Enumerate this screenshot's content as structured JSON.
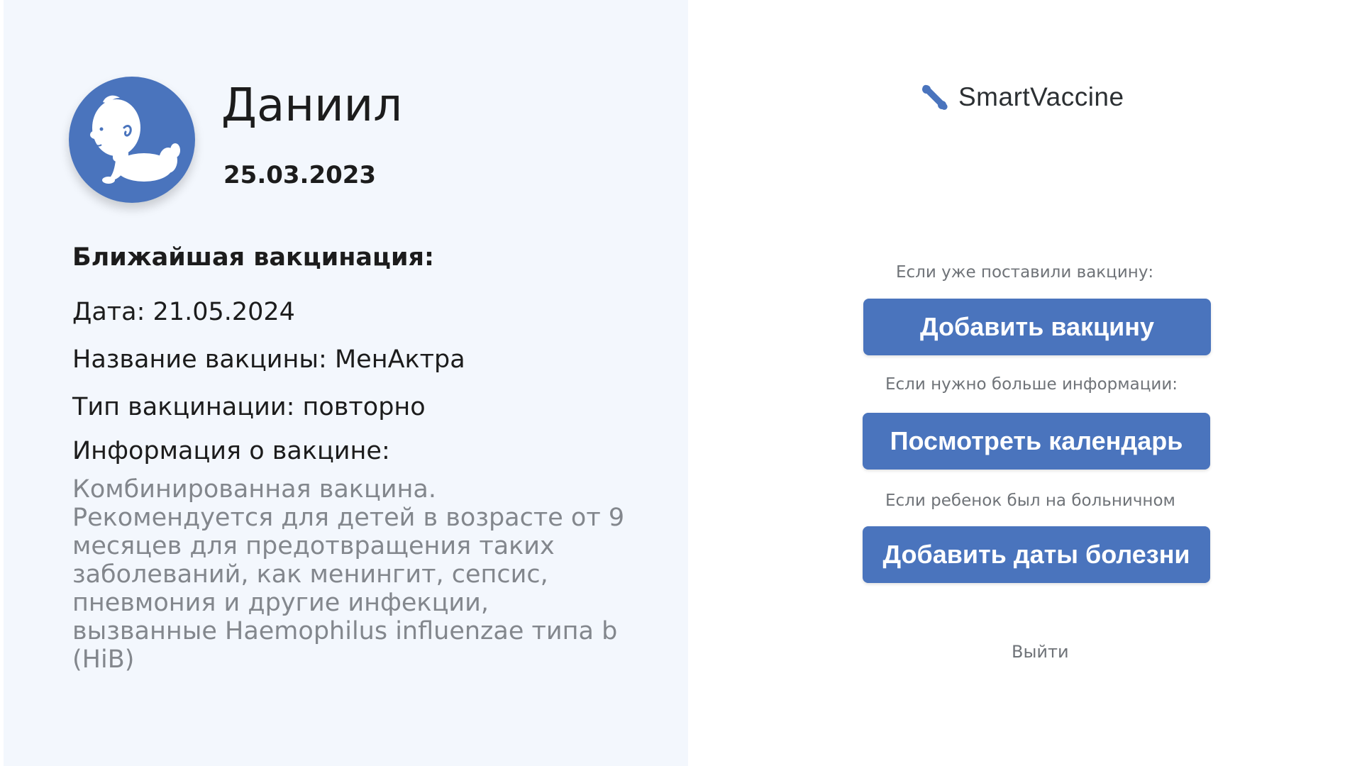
{
  "profile": {
    "name": "Даниил",
    "birthdate": "25.03.2023",
    "avatar_icon": "baby-crawling-icon"
  },
  "next_vaccination": {
    "heading": "Ближайшая вакцинация:",
    "date_line": "Дата: 21.05.2024",
    "name_line": "Название вакцины: МенАктра",
    "type_line": "Тип вакцинации: повторно",
    "info_heading": "Информация о вакцине:",
    "description": "Комбинированная вакцина. Рекомендуется для детей в возрасте от 9 месяцев для предотвращения таких заболеваний, как менингит, сепсис, пневмония и другие инфекции, вызванные Haemophilus influenzae типа b (HiB)"
  },
  "brand": {
    "name": "SmartVaccine",
    "logo_icon": "percent-logo-icon"
  },
  "actions": {
    "hint_add_vaccine": "Если уже поставили вакцину:",
    "add_vaccine_label": "Добавить вакцину",
    "hint_calendar": "Если нужно больше информации:",
    "calendar_label": "Посмотреть календарь",
    "hint_sick_dates": "Если ребенок был на больничном",
    "sick_dates_label": "Добавить даты болезни",
    "logout_label": "Выйти"
  },
  "colors": {
    "accent": "#4a74bd",
    "panel_background": "#f3f7fd",
    "muted_text": "#83878d"
  }
}
